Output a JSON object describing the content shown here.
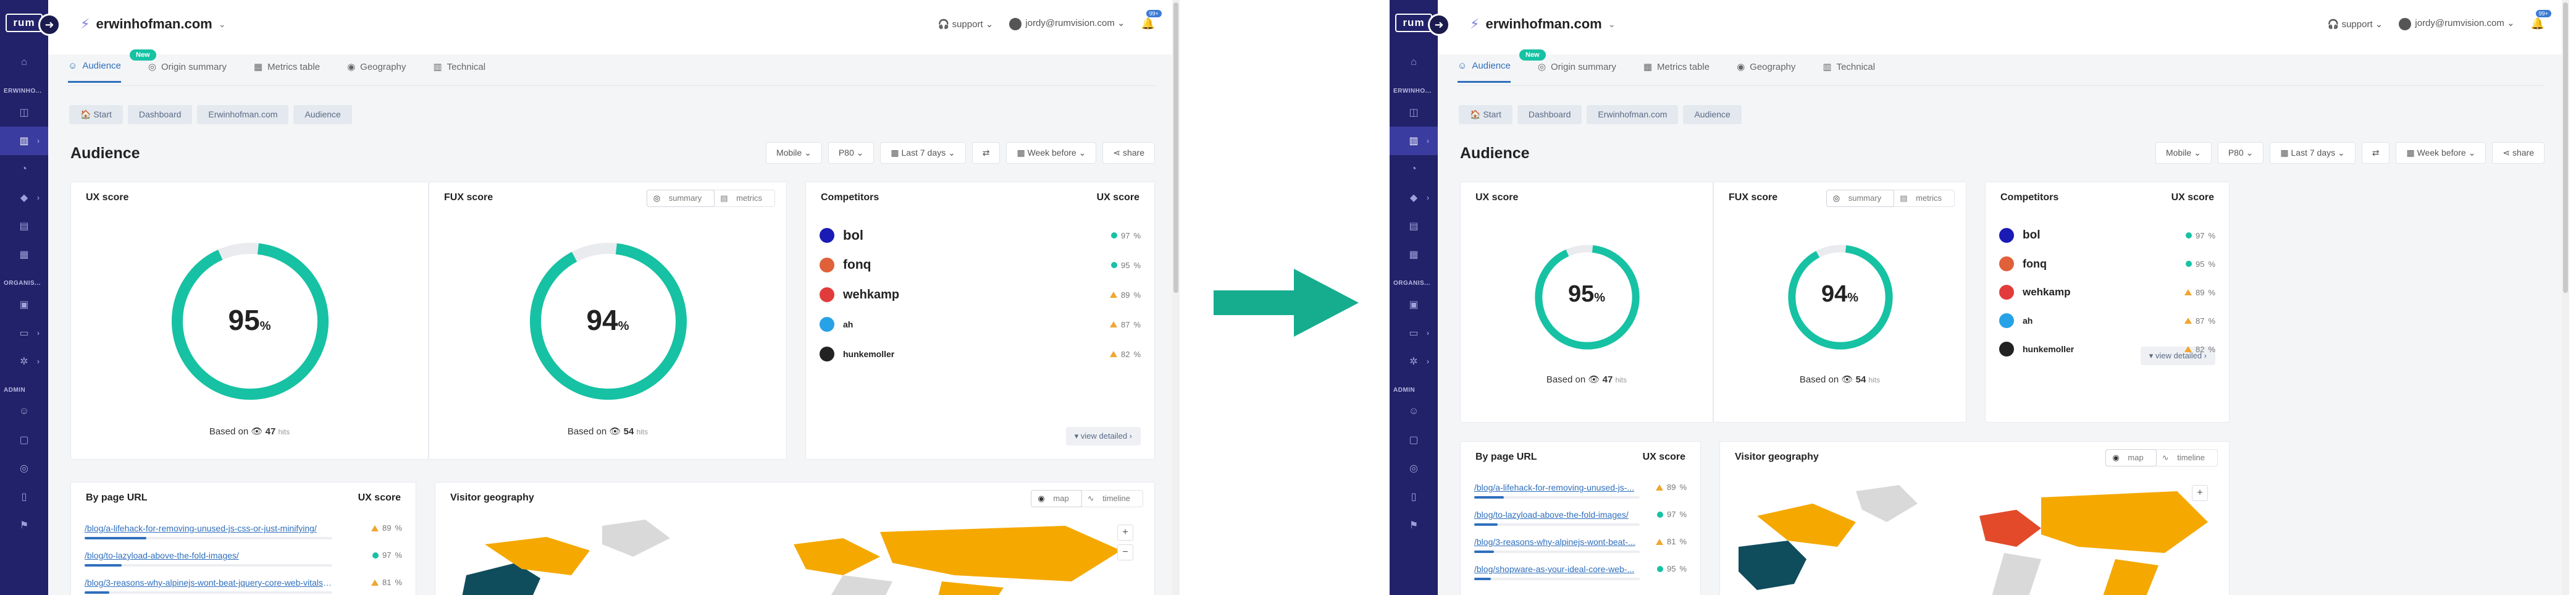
{
  "app": {
    "logo": "rum",
    "site": "erwinhofman.com",
    "support": "support",
    "user_email": "jordy@rumvision.com",
    "notification_count": "99+",
    "sidebar_sections": {
      "site": "ERWINHO...",
      "org": "ORGANIS...",
      "admin": "ADMIN"
    }
  },
  "tabs": [
    {
      "label": "Audience",
      "new": "New"
    },
    {
      "label": "Origin summary"
    },
    {
      "label": "Metrics table"
    },
    {
      "label": "Geography"
    },
    {
      "label": "Technical"
    }
  ],
  "breadcrumb": [
    "Start",
    "Dashboard",
    "Erwinhofman.com",
    "Audience"
  ],
  "page_title": "Audience",
  "filters": [
    "Mobile",
    "P80",
    "Last 7 days",
    "Week before",
    "share"
  ],
  "ux_score": {
    "title": "UX score",
    "value": 95,
    "unit": "%",
    "based_on": "Based on",
    "hits_count": "47",
    "hits_label": "hits"
  },
  "fux_score": {
    "title": "FUX score",
    "value": 94,
    "unit": "%",
    "based_on": "Based on",
    "hits_count": "54",
    "hits_label": "hits",
    "toggle": [
      "summary",
      "metrics"
    ]
  },
  "competitors": {
    "title": "Competitors",
    "score_title": "UX score",
    "rows": [
      {
        "name": "bol",
        "score": "97",
        "status": "good",
        "logo_color": "#1a1ab5"
      },
      {
        "name": "fonq",
        "score": "95",
        "status": "good",
        "logo_color": "#e0603a"
      },
      {
        "name": "wehkamp",
        "score": "89",
        "status": "warn",
        "logo_color": "#e23b3b"
      },
      {
        "name": "ah",
        "score": "87",
        "status": "warn",
        "logo_color": "#27a2e6"
      },
      {
        "name": "hunkemoller",
        "score": "82",
        "status": "warn",
        "logo_color": "#222222"
      }
    ],
    "pct": "%",
    "view_detailed": "view detailed"
  },
  "by_page": {
    "title": "By page URL",
    "score_title": "UX score",
    "rows_left": [
      {
        "url": "/blog/a-lifehack-for-removing-unused-js-css-or-just-minifying/",
        "score": "89",
        "status": "warn",
        "bar": 0.25
      },
      {
        "url": "/blog/to-lazyload-above-the-fold-images/",
        "score": "97",
        "status": "good",
        "bar": 0.15
      },
      {
        "url": "/blog/3-reasons-why-alpinejs-wont-beat-jquery-core-web-vitals-i...",
        "score": "81",
        "status": "warn",
        "bar": 0.1
      }
    ],
    "rows_right": [
      {
        "url": "/blog/a-lifehack-for-removing-unused-js-...",
        "score": "89",
        "status": "warn",
        "bar": 0.18
      },
      {
        "url": "/blog/to-lazyload-above-the-fold-images/",
        "score": "97",
        "status": "good",
        "bar": 0.14
      },
      {
        "url": "/blog/3-reasons-why-alpinejs-wont-beat-...",
        "score": "81",
        "status": "warn",
        "bar": 0.12
      },
      {
        "url": "/blog/shopware-as-your-ideal-core-web-...",
        "score": "95",
        "status": "good",
        "bar": 0.1
      }
    ]
  },
  "geography": {
    "title": "Visitor geography",
    "toggle": [
      "map",
      "timeline"
    ],
    "zoom_in": "+",
    "zoom_out": "−"
  },
  "colors": {
    "sidebar": "#22226a",
    "accent": "#2f6fbd",
    "good": "#16c2a3",
    "warn": "#f0a630",
    "map_orange": "#f5a800",
    "map_teal": "#0f4d5c",
    "arrow": "#16ad8f"
  }
}
